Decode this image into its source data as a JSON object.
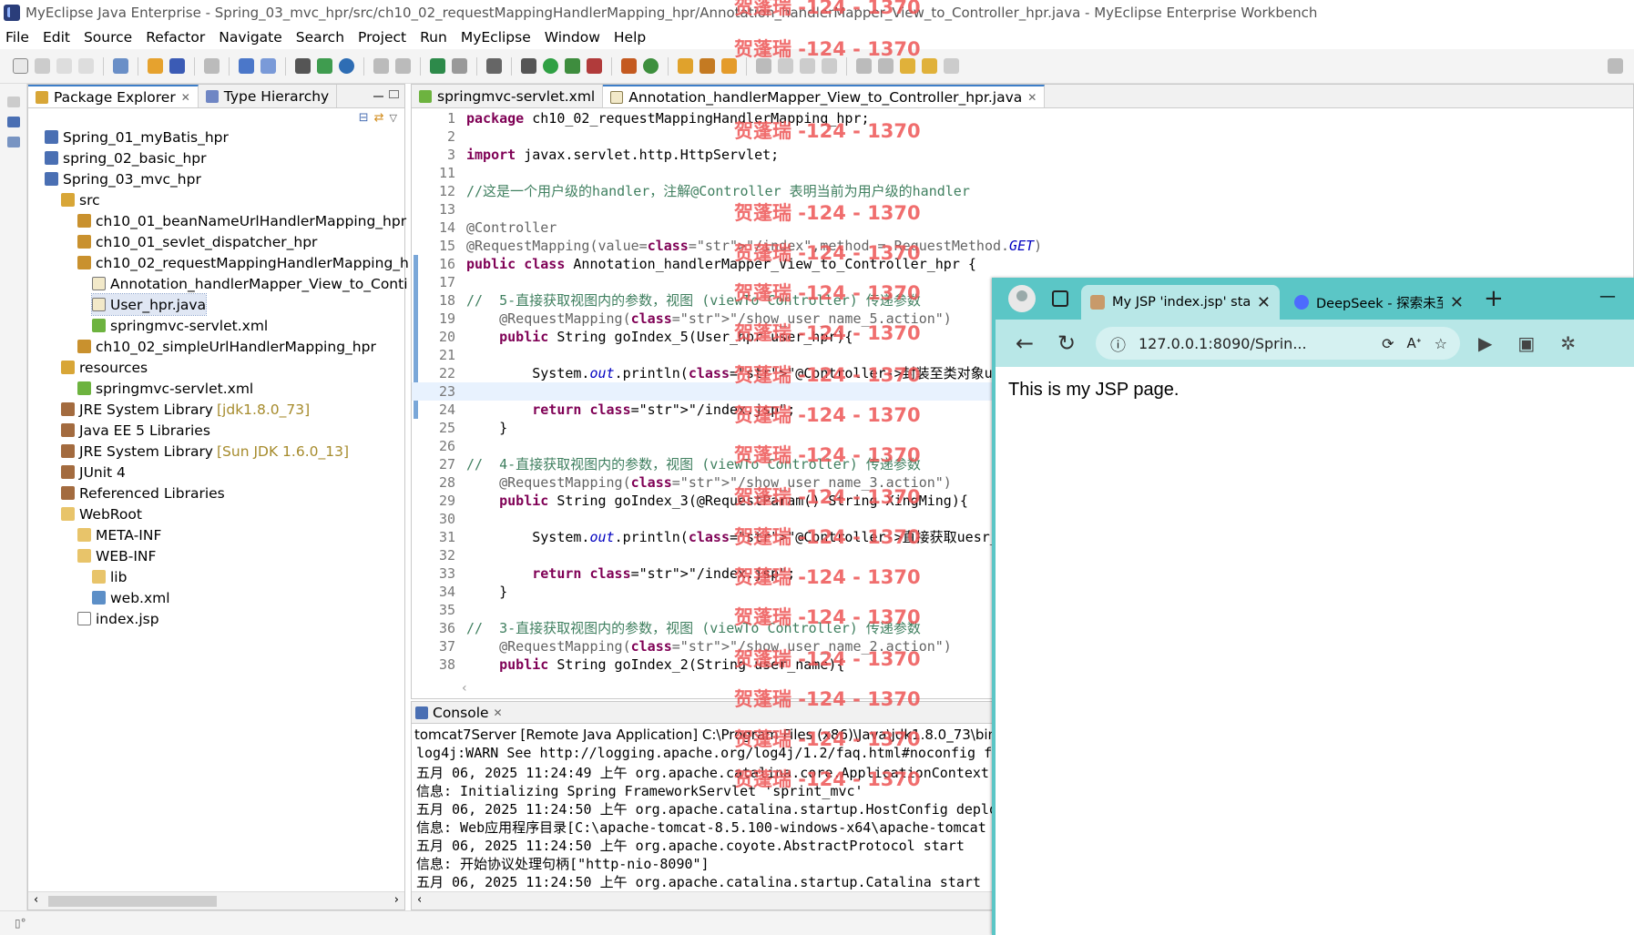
{
  "window": {
    "title": "MyEclipse Java Enterprise - Spring_03_mvc_hpr/src/ch10_02_requestMappingHandlerMapping_hpr/Annotation_handlerMapper_View_to_Controller_hpr.java - MyEclipse Enterprise Workbench"
  },
  "menu": [
    "File",
    "Edit",
    "Source",
    "Refactor",
    "Navigate",
    "Search",
    "Project",
    "Run",
    "MyEclipse",
    "Window",
    "Help"
  ],
  "explorer": {
    "tabs": [
      {
        "label": "Package Explorer"
      },
      {
        "label": "Type Hierarchy"
      }
    ],
    "items": [
      {
        "label": "Spring_01_myBatis_hpr",
        "decor": "",
        "icon": "project-icon"
      },
      {
        "label": "spring_02_basic_hpr",
        "decor": "",
        "icon": "project-icon"
      },
      {
        "label": "Spring_03_mvc_hpr",
        "decor": "",
        "icon": "project-icon"
      },
      {
        "label": "src",
        "decor": "",
        "icon": "source-folder-icon"
      },
      {
        "label": "ch10_01_beanNameUrlHandlerMapping_hpr",
        "decor": "",
        "icon": "package-icon"
      },
      {
        "label": "ch10_01_sevlet_dispatcher_hpr",
        "decor": "",
        "icon": "package-icon"
      },
      {
        "label": "ch10_02_requestMappingHandlerMapping_h",
        "decor": "",
        "icon": "package-icon"
      },
      {
        "label": "Annotation_handlerMapper_View_to_Conti",
        "decor": "",
        "icon": "java-file-icon"
      },
      {
        "label": "User_hpr.java",
        "decor": "",
        "icon": "java-file-icon"
      },
      {
        "label": "springmvc-servlet.xml",
        "decor": "",
        "icon": "spring-xml-icon"
      },
      {
        "label": "ch10_02_simpleUrlHandlerMapping_hpr",
        "decor": "",
        "icon": "package-icon"
      },
      {
        "label": "resources",
        "decor": "",
        "icon": "source-folder-icon"
      },
      {
        "label": "springmvc-servlet.xml",
        "decor": "",
        "icon": "spring-xml-icon"
      },
      {
        "label": "JRE System Library",
        "decor": "[jdk1.8.0_73]",
        "icon": "library-icon"
      },
      {
        "label": "Java EE 5 Libraries",
        "decor": "",
        "icon": "library-icon"
      },
      {
        "label": "JRE System Library",
        "decor": "[Sun JDK 1.6.0_13]",
        "icon": "library-icon"
      },
      {
        "label": "JUnit 4",
        "decor": "",
        "icon": "library-icon"
      },
      {
        "label": "Referenced Libraries",
        "decor": "",
        "icon": "library-icon"
      },
      {
        "label": "WebRoot",
        "decor": "",
        "icon": "folder-icon"
      },
      {
        "label": "META-INF",
        "decor": "",
        "icon": "folder-icon"
      },
      {
        "label": "WEB-INF",
        "decor": "",
        "icon": "folder-icon"
      },
      {
        "label": "lib",
        "decor": "",
        "icon": "folder-icon"
      },
      {
        "label": "web.xml",
        "decor": "",
        "icon": "xml-file-icon"
      },
      {
        "label": "index.jsp",
        "decor": "",
        "icon": "jsp-file-icon"
      }
    ]
  },
  "editor": {
    "tabs": [
      {
        "label": "springmvc-servlet.xml"
      },
      {
        "label": "Annotation_handlerMapper_View_to_Controller_hpr.java"
      }
    ],
    "lines": [
      {
        "n": "1",
        "t": "package ch10_02_requestMappingHandlerMapping_hpr;"
      },
      {
        "n": "2",
        "t": ""
      },
      {
        "n": "3",
        "t": "import javax.servlet.http.HttpServlet;"
      },
      {
        "n": "11",
        "t": ""
      },
      {
        "n": "12",
        "t": "//这是一个用户级的handler，注解@Controller 表明当前为用户级的handler"
      },
      {
        "n": "13",
        "t": ""
      },
      {
        "n": "14",
        "t": "@Controller"
      },
      {
        "n": "15",
        "t": "@RequestMapping(value=\"/index\",method = RequestMethod.GET)"
      },
      {
        "n": "16",
        "t": "public class Annotation_handlerMapper_View_to_Controller_hpr {"
      },
      {
        "n": "17",
        "t": ""
      },
      {
        "n": "18",
        "t": "//  5-直接获取视图内的参数，视图 (viewTo Controller) 传递参数"
      },
      {
        "n": "19",
        "t": "    @RequestMapping(\"/show_user_name_5.action\")"
      },
      {
        "n": "20",
        "t": "    public String goIndex_5(User_hpr user_hpr){"
      },
      {
        "n": "21",
        "t": ""
      },
      {
        "n": "22",
        "t": "        System.out.println(\"@Controller->封装至类对象user_hpr->\"+us"
      },
      {
        "n": "23",
        "t": ""
      },
      {
        "n": "24",
        "t": "        return \"/index.jsp\";"
      },
      {
        "n": "25",
        "t": "    }"
      },
      {
        "n": "26",
        "t": ""
      },
      {
        "n": "27",
        "t": "//  4-直接获取视图内的参数，视图 (viewTo Controller) 传递参数"
      },
      {
        "n": "28",
        "t": "    @RequestMapping(\"/show_user_name_3.action\")"
      },
      {
        "n": "29",
        "t": "    public String goIndex_3(@RequestParam() String XingMing){"
      },
      {
        "n": "30",
        "t": ""
      },
      {
        "n": "31",
        "t": "        System.out.println(\"@Controller->直接获取uesr_name->\"+XingM"
      },
      {
        "n": "32",
        "t": ""
      },
      {
        "n": "33",
        "t": "        return \"/index.jsp\";"
      },
      {
        "n": "34",
        "t": "    }"
      },
      {
        "n": "35",
        "t": ""
      },
      {
        "n": "36",
        "t": "//  3-直接获取视图内的参数，视图 (viewTo Controller) 传递参数"
      },
      {
        "n": "37",
        "t": "    @RequestMapping(\"/show_user_name_2.action\")"
      },
      {
        "n": "38",
        "t": "    public String goIndex_2(String user_name){"
      }
    ]
  },
  "console": {
    "tab": "Console",
    "header": "tomcat7Server [Remote Java Application] C:\\Program Files (x86)\\Java\\jdk1.8.0_73\\bin\\ja",
    "lines": [
      "log4j:WARN See http://logging.apache.org/log4j/1.2/faq.html#noconfig fo",
      "五月 06, 2025 11:24:49 上午 org.apache.catalina.core.ApplicationContext",
      "信息: Initializing Spring FrameworkServlet 'sprint_mvc'",
      "五月 06, 2025 11:24:50 上午 org.apache.catalina.startup.HostConfig deplo",
      "信息: Web应用程序目录[C:\\apache-tomcat-8.5.100-windows-x64\\apache-tomcat",
      "五月 06, 2025 11:24:50 上午 org.apache.coyote.AbstractProtocol start",
      "信息: 开始协议处理句柄[\"http-nio-8090\"]",
      "五月 06, 2025 11:24:50 上午 org.apache.catalina.startup.Catalina start"
    ]
  },
  "browser": {
    "tabs": [
      {
        "title": "My JSP 'index.jsp' sta"
      },
      {
        "title": "DeepSeek - 探索未至"
      }
    ],
    "url": "127.0.0.1:8090/Sprin...",
    "content": "This is my JSP page."
  },
  "watermark": "贺蓬瑞 -124 - 1370"
}
